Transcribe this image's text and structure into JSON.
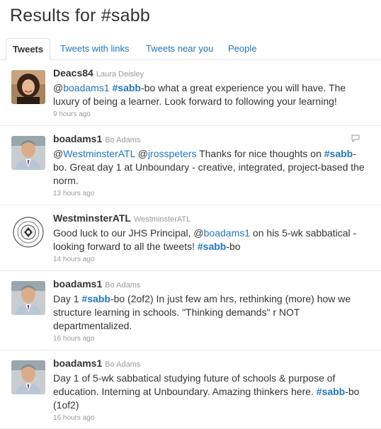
{
  "page": {
    "title": "Results for #sabb"
  },
  "tabs": [
    {
      "label": "Tweets"
    },
    {
      "label": "Tweets with links"
    },
    {
      "label": "Tweets near you"
    },
    {
      "label": "People"
    }
  ],
  "tweets": [
    {
      "screen_name": "Deacs84",
      "full_name": "Laura Deisley",
      "parts": [
        {
          "t": "@"
        },
        {
          "l": "boadams1"
        },
        {
          "t": " "
        },
        {
          "h": "#sabb"
        },
        {
          "t": "-bo what a great experience you will have. The luxury of being a learner. Look forward to following your learning!"
        }
      ],
      "time": "9 hours ago",
      "avatar": "woman-photo"
    },
    {
      "screen_name": "boadams1",
      "full_name": "Bo Adams",
      "parts": [
        {
          "t": "@"
        },
        {
          "l": "WestminsterATL"
        },
        {
          "t": " @"
        },
        {
          "l": "jrosspeters"
        },
        {
          "t": " Thanks for nice thoughts on "
        },
        {
          "h": "#sabb"
        },
        {
          "t": "-bo. Great day 1 at Unboundary - creative, integrated, project-based the norm."
        }
      ],
      "time": "13 hours ago",
      "avatar": "man-photo"
    },
    {
      "screen_name": "WestminsterATL",
      "full_name": "WestminsterATL",
      "parts": [
        {
          "t": "Good luck to our JHS Principal, @"
        },
        {
          "l": "boadams1"
        },
        {
          "t": " on his 5-wk sabbatical - looking forward to all the tweets! "
        },
        {
          "h": "#sabb"
        },
        {
          "t": "-bo"
        }
      ],
      "time": "14 hours ago",
      "avatar": "school-seal"
    },
    {
      "screen_name": "boadams1",
      "full_name": "Bo Adams",
      "parts": [
        {
          "t": "Day 1 "
        },
        {
          "h": "#sabb"
        },
        {
          "t": "-bo (2of2) In just few am hrs, rethinking (more) how we structure learning in schools. \"Thinking demands\" r NOT departmentalized."
        }
      ],
      "time": "16 hours ago",
      "avatar": "man-photo"
    },
    {
      "screen_name": "boadams1",
      "full_name": "Bo Adams",
      "parts": [
        {
          "t": "Day 1 of 5-wk sabbatical studying future of schools & purpose of education. Interning at Unboundary. Amazing thinkers here. "
        },
        {
          "h": "#sabb"
        },
        {
          "t": "-bo (1of2)"
        }
      ],
      "time": "16 hours ago",
      "avatar": "man-photo"
    }
  ],
  "colors": {
    "link": "#2276bb",
    "muted": "#999999",
    "text": "#333333"
  }
}
